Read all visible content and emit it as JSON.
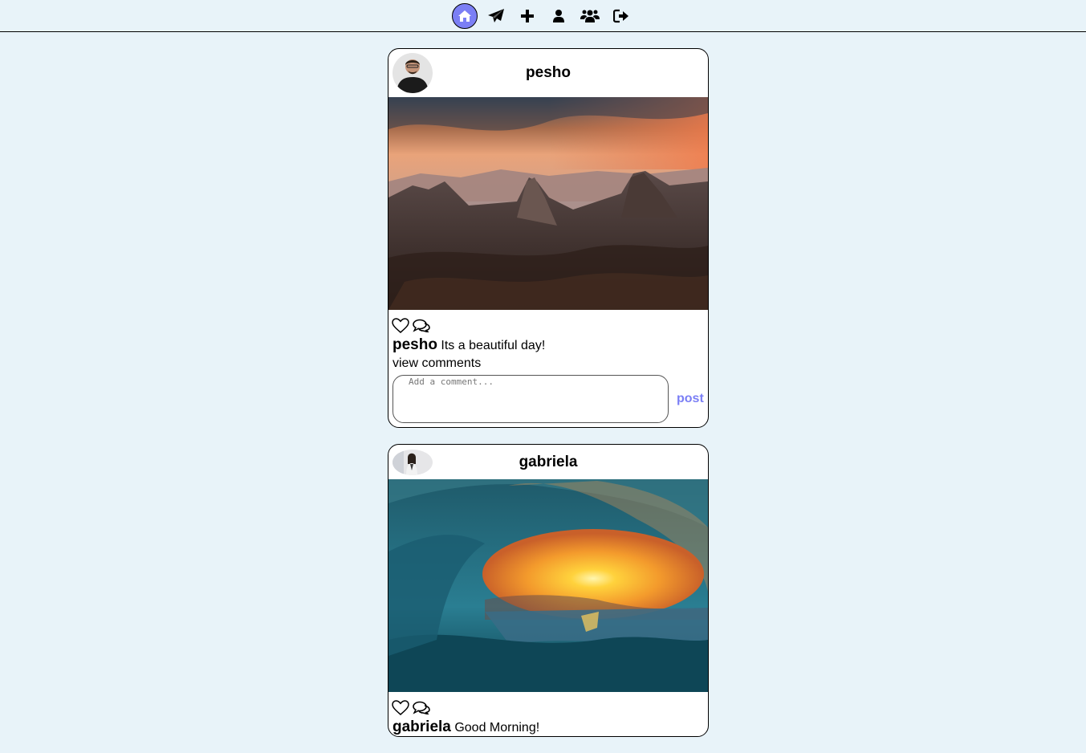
{
  "nav": {
    "items": [
      {
        "icon": "home-icon",
        "active": true
      },
      {
        "icon": "send-icon"
      },
      {
        "icon": "plus-icon"
      },
      {
        "icon": "user-icon"
      },
      {
        "icon": "users-icon"
      },
      {
        "icon": "logout-icon"
      }
    ],
    "accent": "#7b7ff5"
  },
  "posts": [
    {
      "username": "pesho",
      "caption": "Its a beautiful day!",
      "view_comments": "view comments",
      "comment_placeholder": "Add a comment...",
      "post_label": "post"
    },
    {
      "username": "gabriela",
      "caption": "Good Morning!"
    }
  ]
}
